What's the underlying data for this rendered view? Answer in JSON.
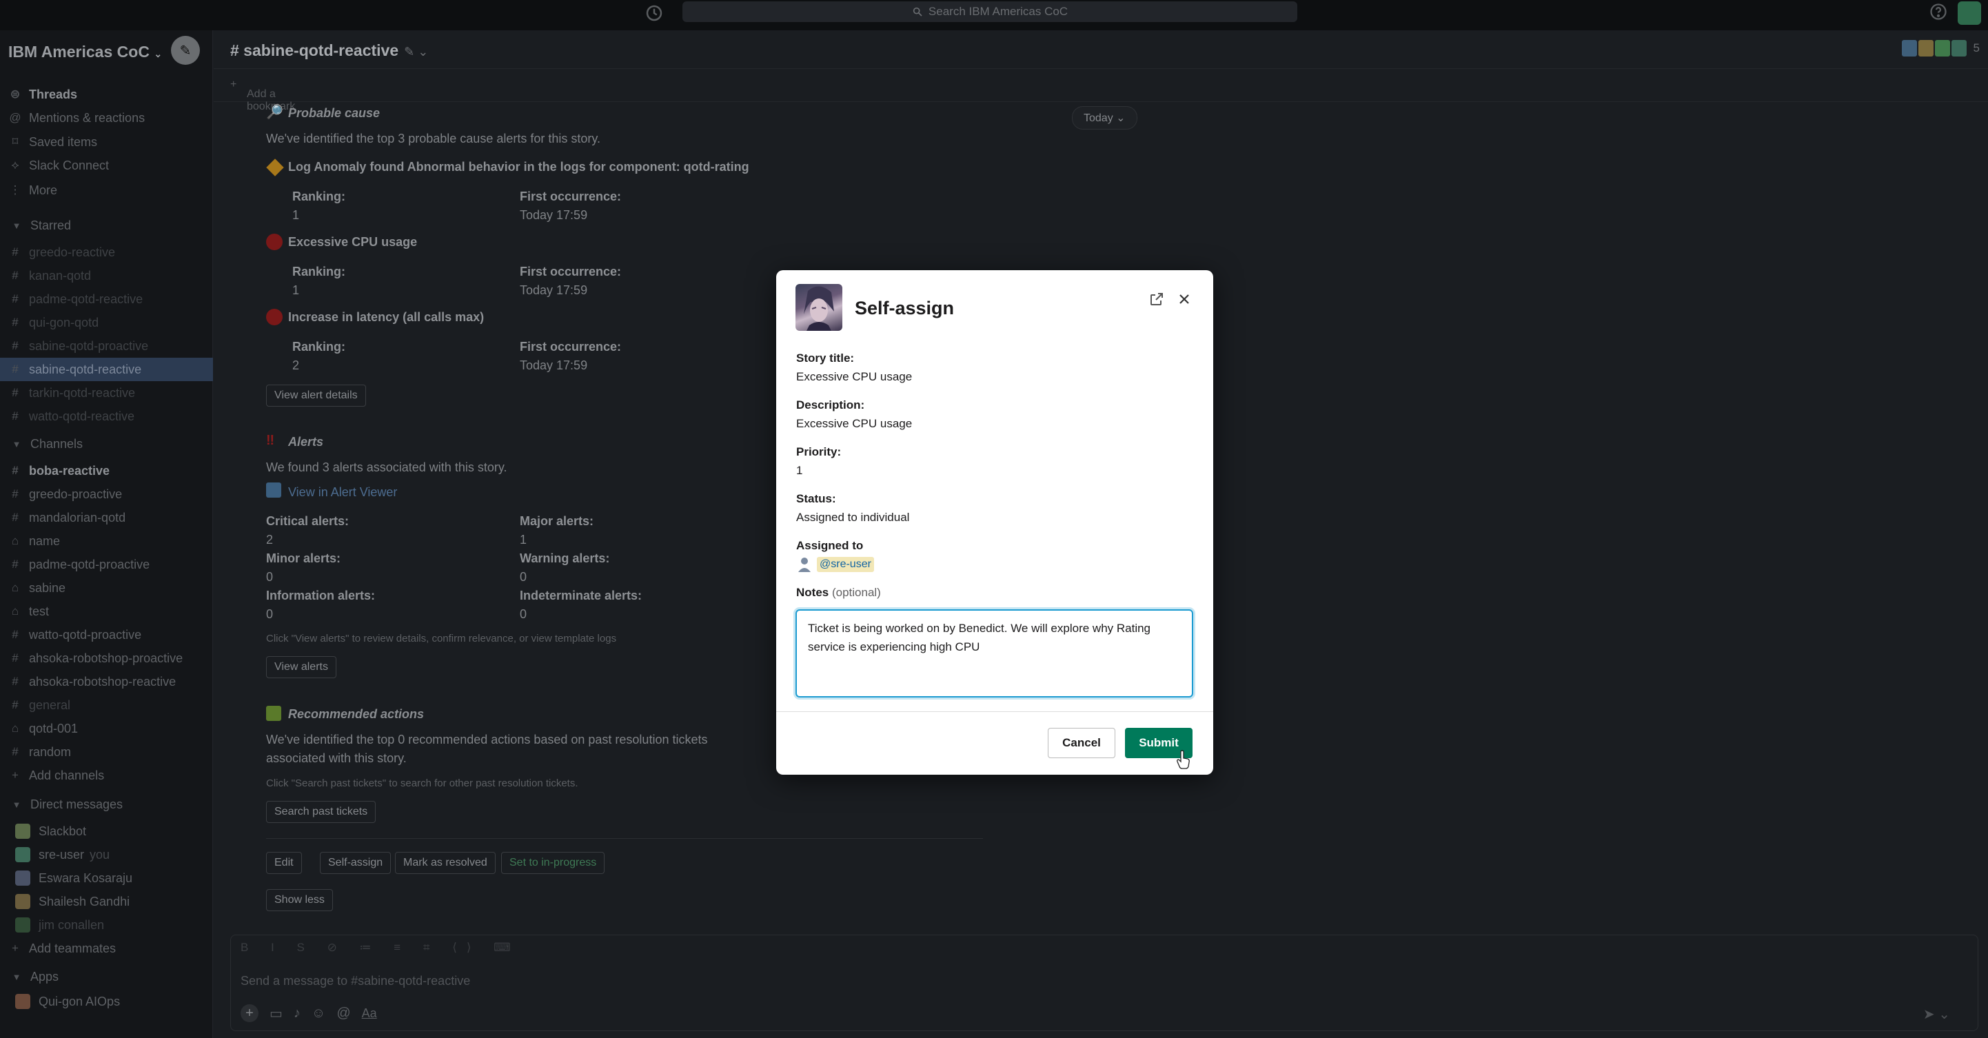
{
  "topbar": {
    "search_placeholder": "Search IBM Americas CoC"
  },
  "sidebar": {
    "workspace": "IBM Americas CoC",
    "nav": [
      {
        "label": "Threads",
        "icon": "threads-icon"
      },
      {
        "label": "Mentions & reactions",
        "icon": "at-icon"
      },
      {
        "label": "Saved items",
        "icon": "bookmark-icon"
      },
      {
        "label": "Slack Connect",
        "icon": "connect-icon"
      },
      {
        "label": "More",
        "icon": "more-icon"
      }
    ],
    "starred_header": "Starred",
    "starred": [
      "greedo-reactive",
      "kanan-qotd",
      "padme-qotd-reactive",
      "qui-gon-qotd",
      "sabine-qotd-proactive",
      "sabine-qotd-reactive",
      "tarkin-qotd-reactive",
      "watto-qotd-reactive"
    ],
    "channels_header": "Channels",
    "channels": [
      "boba-reactive",
      "greedo-proactive",
      "mandalorian-qotd",
      "name",
      "padme-qotd-proactive",
      "sabine",
      "test",
      "watto-qotd-proactive",
      "ahsoka-robotshop-proactive",
      "ahsoka-robotshop-reactive",
      "general",
      "qotd-001",
      "random"
    ],
    "add_channels": "Add channels",
    "dm_header": "Direct messages",
    "dms": [
      "Slackbot",
      "sre-user",
      "Eswara Kosaraju",
      "Shailesh Gandhi",
      "jim conallen"
    ],
    "you_label": "you",
    "add_teammates": "Add teammates",
    "apps_header": "Apps",
    "apps": [
      "Qui-gon AIOps"
    ]
  },
  "channel": {
    "name": "# sabine-qotd-reactive",
    "add_bookmark": "Add a bookmark",
    "member_count": "5",
    "today": "Today"
  },
  "message": {
    "probable_cause_title": "Probable cause",
    "probable_cause_text": "We've identified the top 3 probable cause alerts for this story.",
    "causes": [
      {
        "title": "Log Anomaly found Abnormal behavior in the logs for component: qotd-rating",
        "ranking": "1",
        "first": "Today 17:59"
      },
      {
        "title": "Excessive CPU usage",
        "ranking": "1",
        "first": "Today 17:59"
      },
      {
        "title": "Increase in latency (all calls max)",
        "ranking": "2",
        "first": "Today 17:59"
      }
    ],
    "ranking_label": "Ranking:",
    "first_label": "First occurrence:",
    "view_alert_details": "View alert details",
    "alerts_title": "Alerts",
    "alerts_text": "We found 3 alerts associated with this story.",
    "view_in_alert_viewer": "View in Alert Viewer",
    "critical_label": "Critical alerts:",
    "critical": "2",
    "major_label": "Major alerts:",
    "major": "1",
    "minor_label": "Minor alerts:",
    "minor": "0",
    "warning_label": "Warning alerts:",
    "warning": "0",
    "info_label": "Information alerts:",
    "info": "0",
    "indeterminate_label": "Indeterminate alerts:",
    "indeterminate": "0",
    "alerts_hint": "Click \"View alerts\" to review details, confirm relevance, or view template logs",
    "view_alerts": "View alerts",
    "recommended_title": "Recommended actions",
    "recommended_text_1": "We've identified the top 0 recommended actions based on past resolution tickets",
    "recommended_text_2": "associated with this story.",
    "recommended_hint": "Click \"Search past tickets\" to search for other past resolution tickets.",
    "search_past_tickets": "Search past tickets",
    "actions": {
      "edit": "Edit",
      "self_assign": "Self-assign",
      "mark_resolved": "Mark as resolved",
      "set_in_progress": "Set to in-progress"
    },
    "show_less": "Show less"
  },
  "composer": {
    "placeholder": "Send a message to #sabine-qotd-reactive"
  },
  "modal": {
    "title": "Self-assign",
    "story_title_label": "Story title:",
    "story_title": "Excessive CPU usage",
    "description_label": "Description:",
    "description": "Excessive CPU usage",
    "priority_label": "Priority:",
    "priority": "1",
    "status_label": "Status:",
    "status": "Assigned to individual",
    "assigned_label": "Assigned to",
    "assigned_user": "@sre-user",
    "notes_label": "Notes",
    "notes_optional": "(optional)",
    "notes_value": "Ticket is being worked on by Benedict. We will explore why Rating service is experiencing high CPU",
    "cancel": "Cancel",
    "submit": "Submit"
  }
}
